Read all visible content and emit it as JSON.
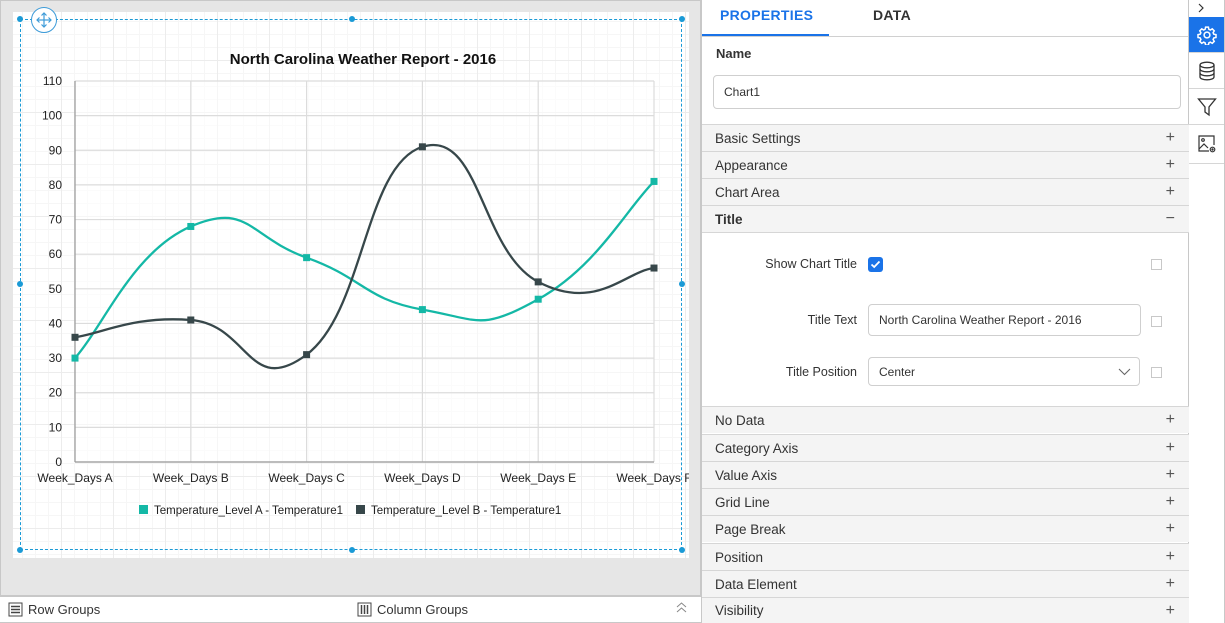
{
  "canvas": {
    "bottom_bar": {
      "row_groups_label": "Row Groups",
      "column_groups_label": "Column Groups"
    }
  },
  "chart_data": {
    "type": "line",
    "title": "North Carolina Weather Report - 2016",
    "categories": [
      "Week_Days A",
      "Week_Days B",
      "Week_Days C",
      "Week_Days D",
      "Week_Days E",
      "Week_Days F"
    ],
    "series": [
      {
        "name": "Temperature_Level A - Temperature1",
        "color": "#14b8a6",
        "values": [
          30,
          68,
          59,
          44,
          47,
          81
        ]
      },
      {
        "name": "Temperature_Level B - Temperature1",
        "color": "#37474a",
        "values": [
          36,
          41,
          31,
          91,
          52,
          56
        ]
      }
    ],
    "xlabel": "",
    "ylabel": "",
    "ylim": [
      0,
      110
    ],
    "yticks": [
      "0",
      "10",
      "20",
      "30",
      "40",
      "50",
      "60",
      "70",
      "80",
      "90",
      "100",
      "110"
    ],
    "grid": true,
    "smooth": true,
    "legend_position": "bottom"
  },
  "properties": {
    "tabs": [
      {
        "label": "PROPERTIES",
        "active": true
      },
      {
        "label": "DATA",
        "active": false
      }
    ],
    "name_label": "Name",
    "name_value": "Chart1",
    "sections_top": [
      {
        "label": "Basic Settings",
        "toggle": "+"
      },
      {
        "label": "Appearance",
        "toggle": "+"
      },
      {
        "label": "Chart Area",
        "toggle": "+"
      },
      {
        "label": "Title",
        "toggle": "−"
      }
    ],
    "title_section": {
      "show_chart_title_label": "Show Chart Title",
      "show_chart_title_checked": true,
      "title_text_label": "Title Text",
      "title_text_value": "North Carolina Weather Report - 2016",
      "title_position_label": "Title Position",
      "title_position_value": "Center"
    },
    "sections_bottom": [
      {
        "label": "No Data",
        "toggle": "+"
      },
      {
        "label": "Category Axis",
        "toggle": "+"
      },
      {
        "label": "Value Axis",
        "toggle": "+"
      },
      {
        "label": "Grid Line",
        "toggle": "+"
      },
      {
        "label": "Page Break",
        "toggle": "+"
      },
      {
        "label": "Position",
        "toggle": "+"
      },
      {
        "label": "Data Element",
        "toggle": "+"
      },
      {
        "label": "Visibility",
        "toggle": "+"
      }
    ]
  },
  "side_rail": {
    "collapse_icon": "chevron-right-icon",
    "buttons": [
      {
        "icon": "gear-icon",
        "active": true
      },
      {
        "icon": "database-icon",
        "active": false
      },
      {
        "icon": "filter-icon",
        "active": false
      },
      {
        "icon": "image-settings-icon",
        "active": false
      }
    ]
  },
  "colors": {
    "accent": "#1a73e8",
    "selection": "#1a9ad6"
  }
}
